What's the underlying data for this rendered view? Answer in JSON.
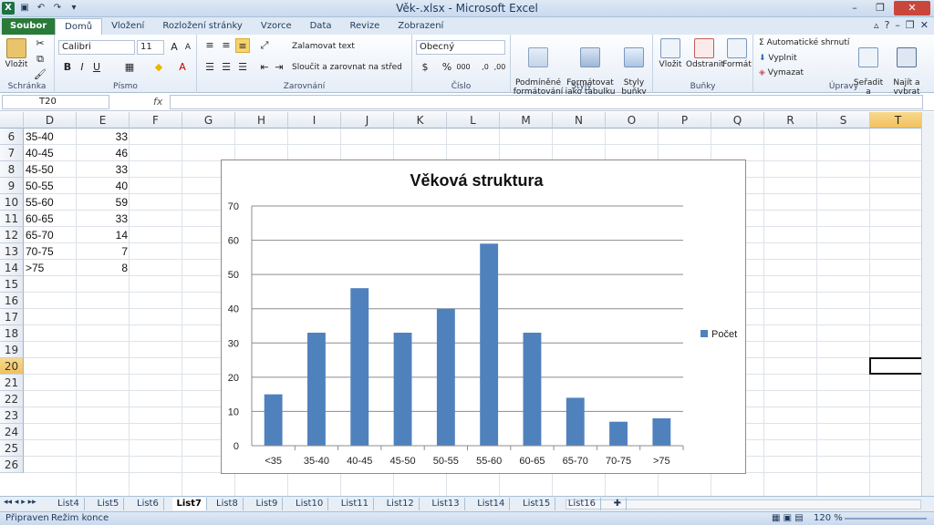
{
  "window": {
    "title": "Věk-.xlsx - Microsoft Excel"
  },
  "tabs": [
    {
      "label": "Soubor"
    },
    {
      "label": "Domů"
    },
    {
      "label": "Vložení"
    },
    {
      "label": "Rozložení stránky"
    },
    {
      "label": "Vzorce"
    },
    {
      "label": "Data"
    },
    {
      "label": "Revize"
    },
    {
      "label": "Zobrazení"
    }
  ],
  "ribbon": {
    "clipboard": {
      "paste": "Vložit",
      "group": "Schránka"
    },
    "font": {
      "name": "Calibri",
      "size": "11",
      "group": "Písmo"
    },
    "alignment": {
      "wrap": "Zalamovat text",
      "merge": "Sloučit a zarovnat na střed",
      "group": "Zarovnání"
    },
    "number": {
      "format": "Obecný",
      "group": "Číslo"
    },
    "styles": {
      "conditional": "Podmíněné\nformátování",
      "astable": "Formátovat\njako tabulku",
      "cellstyles": "Styly\nbuňky",
      "group": "Styly"
    },
    "cells": {
      "insert": "Vložit",
      "delete": "Odstranit",
      "format": "Formát",
      "group": "Buňky"
    },
    "editing": {
      "autosum": "Automatické shrnutí",
      "fill": "Vyplnit",
      "clear": "Vymazat",
      "sort": "Seřadit a\nfiltrovat",
      "find": "Najít a\nvybrat",
      "group": "Úpravy"
    }
  },
  "formula_bar": {
    "name_box": "T20",
    "fx": "fx",
    "value": ""
  },
  "columns": [
    "D",
    "E",
    "F",
    "G",
    "H",
    "I",
    "J",
    "K",
    "L",
    "M",
    "N",
    "O",
    "P",
    "Q",
    "R",
    "S",
    "T"
  ],
  "rows": [
    "6",
    "7",
    "8",
    "9",
    "10",
    "11",
    "12",
    "13",
    "14",
    "15",
    "16",
    "17",
    "18",
    "19",
    "20",
    "21",
    "22",
    "23",
    "24",
    "25",
    "26"
  ],
  "cells": [
    {
      "d": "35-40",
      "e": "33"
    },
    {
      "d": "40-45",
      "e": "46"
    },
    {
      "d": "45-50",
      "e": "33"
    },
    {
      "d": "50-55",
      "e": "40"
    },
    {
      "d": "55-60",
      "e": "59"
    },
    {
      "d": "60-65",
      "e": "33"
    },
    {
      "d": "65-70",
      "e": "14"
    },
    {
      "d": "70-75",
      "e": "7"
    },
    {
      "d": ">75",
      "e": "8"
    }
  ],
  "selected_cell": "T20",
  "chart_data": {
    "type": "bar",
    "title": "Věková struktura",
    "categories": [
      "<35",
      "35-40",
      "40-45",
      "45-50",
      "50-55",
      "55-60",
      "60-65",
      "65-70",
      "70-75",
      ">75"
    ],
    "series": [
      {
        "name": "Počet",
        "values": [
          15,
          33,
          46,
          33,
          40,
          59,
          33,
          14,
          7,
          8
        ],
        "color": "#4f81bd"
      }
    ],
    "ylim": [
      0,
      70
    ],
    "yticks": [
      0,
      10,
      20,
      30,
      40,
      50,
      60,
      70
    ],
    "grid": true,
    "legend": "right"
  },
  "sheets": [
    "List4",
    "List5",
    "List6",
    "List7",
    "List8",
    "List9",
    "List10",
    "List11",
    "List12",
    "List13",
    "List14",
    "List15",
    "List16"
  ],
  "active_sheet": "List7",
  "status": {
    "ready": "Připraven",
    "mode": "Režim konce",
    "zoom": "120 %"
  }
}
